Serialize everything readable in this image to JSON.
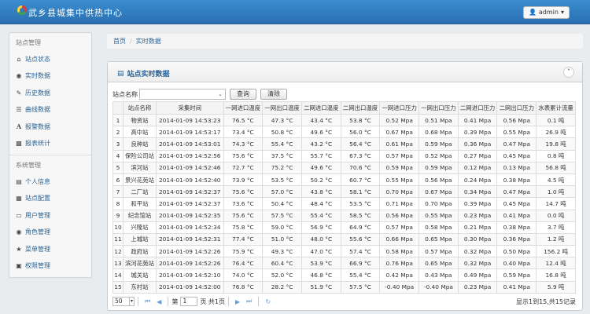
{
  "header": {
    "title": "武乡县城集中供热中心",
    "user_label": "admin",
    "user_icon": "user-icon"
  },
  "sidebar": {
    "section1": "站点管理",
    "items1": [
      {
        "label": "站点状态",
        "icon": "home-icon"
      },
      {
        "label": "实时数据",
        "icon": "eye-icon"
      },
      {
        "label": "历史数据",
        "icon": "edit-icon"
      },
      {
        "label": "曲线数据",
        "icon": "list-icon"
      },
      {
        "label": "报警数据",
        "icon": "font-icon"
      },
      {
        "label": "报表统计",
        "icon": "picture-icon"
      }
    ],
    "section2": "系统管理",
    "items2": [
      {
        "label": "个人信息",
        "icon": "list-alt-icon"
      },
      {
        "label": "站点配置",
        "icon": "grid-icon"
      },
      {
        "label": "用户管理",
        "icon": "folder-icon"
      },
      {
        "label": "角色管理",
        "icon": "globe-icon"
      },
      {
        "label": "菜单管理",
        "icon": "star-icon"
      },
      {
        "label": "权限管理",
        "icon": "lock-icon"
      }
    ]
  },
  "breadcrumb": {
    "home": "首页",
    "current": "实时数据"
  },
  "panel": {
    "title": "站点实时数据"
  },
  "filter": {
    "label": "站点名称",
    "select_value": "",
    "query": "查询",
    "clear": "清除"
  },
  "table": {
    "headers": [
      "",
      "站点名称",
      "采集时间",
      "一网进口温度",
      "一网出口温度",
      "二网进口温度",
      "二网出口温度",
      "一网进口压力",
      "一网出口压力",
      "二网进口压力",
      "二网出口压力",
      "水表累计流量"
    ],
    "rows": [
      [
        "1",
        "物资站",
        "2014-01-09 14:53:23",
        "76.5 °C",
        "47.3 °C",
        "43.4 °C",
        "53.8 °C",
        "0.52 Mpa",
        "0.51 Mpa",
        "0.41 Mpa",
        "0.56 Mpa",
        "0.1 吨"
      ],
      [
        "2",
        "高中站",
        "2014-01-09 14:53:17",
        "73.4 °C",
        "50.8 °C",
        "49.6 °C",
        "56.0 °C",
        "0.67 Mpa",
        "0.68 Mpa",
        "0.39 Mpa",
        "0.55 Mpa",
        "26.9 吨"
      ],
      [
        "3",
        "良种站",
        "2014-01-09 14:53:01",
        "74.3 °C",
        "55.4 °C",
        "43.2 °C",
        "56.4 °C",
        "0.61 Mpa",
        "0.59 Mpa",
        "0.36 Mpa",
        "0.47 Mpa",
        "19.8 吨"
      ],
      [
        "4",
        "保险公司站",
        "2014-01-09 14:52:56",
        "75.6 °C",
        "37.5 °C",
        "55.7 °C",
        "67.3 °C",
        "0.57 Mpa",
        "0.52 Mpa",
        "0.27 Mpa",
        "0.45 Mpa",
        "0.8 吨"
      ],
      [
        "5",
        "滨河站",
        "2014-01-09 14:52:46",
        "72.7 °C",
        "75.2 °C",
        "49.6 °C",
        "70.6 °C",
        "0.59 Mpa",
        "0.59 Mpa",
        "0.12 Mpa",
        "0.13 Mpa",
        "56.8 吨"
      ],
      [
        "6",
        "景兴花苑站",
        "2014-01-09 14:52:40",
        "73.9 °C",
        "53.5 °C",
        "50.2 °C",
        "60.7 °C",
        "0.55 Mpa",
        "0.56 Mpa",
        "0.24 Mpa",
        "0.38 Mpa",
        "4.5 吨"
      ],
      [
        "7",
        "二厂站",
        "2014-01-09 14:52:37",
        "75.6 °C",
        "57.0 °C",
        "43.8 °C",
        "58.1 °C",
        "0.70 Mpa",
        "0.67 Mpa",
        "0.34 Mpa",
        "0.47 Mpa",
        "1.0 吨"
      ],
      [
        "8",
        "和平站",
        "2014-01-09 14:52:37",
        "73.6 °C",
        "50.4 °C",
        "48.4 °C",
        "53.5 °C",
        "0.71 Mpa",
        "0.70 Mpa",
        "0.39 Mpa",
        "0.45 Mpa",
        "14.7 吨"
      ],
      [
        "9",
        "纪念馆站",
        "2014-01-09 14:52:35",
        "75.6 °C",
        "57.5 °C",
        "55.4 °C",
        "58.5 °C",
        "0.56 Mpa",
        "0.55 Mpa",
        "0.23 Mpa",
        "0.41 Mpa",
        "0.0 吨"
      ],
      [
        "10",
        "兴隆站",
        "2014-01-09 14:52:34",
        "75.8 °C",
        "59.0 °C",
        "56.9 °C",
        "64.9 °C",
        "0.57 Mpa",
        "0.58 Mpa",
        "0.21 Mpa",
        "0.38 Mpa",
        "3.7 吨"
      ],
      [
        "11",
        "上城站",
        "2014-01-09 14:52:31",
        "77.4 °C",
        "51.0 °C",
        "48.0 °C",
        "55.6 °C",
        "0.66 Mpa",
        "0.65 Mpa",
        "0.30 Mpa",
        "0.36 Mpa",
        "1.2 吨"
      ],
      [
        "12",
        "政府站",
        "2014-01-09 14:52:26",
        "75.9 °C",
        "49.3 °C",
        "47.0 °C",
        "57.4 °C",
        "0.58 Mpa",
        "0.57 Mpa",
        "0.32 Mpa",
        "0.50 Mpa",
        "156.2 吨"
      ],
      [
        "13",
        "滨河花苑站",
        "2014-01-09 14:52:26",
        "76.4 °C",
        "60.4 °C",
        "53.9 °C",
        "66.9 °C",
        "0.76 Mpa",
        "0.65 Mpa",
        "0.32 Mpa",
        "0.40 Mpa",
        "12.4 吨"
      ],
      [
        "14",
        "城关站",
        "2014-01-09 14:52:10",
        "74.0 °C",
        "52.0 °C",
        "46.8 °C",
        "55.4 °C",
        "0.42 Mpa",
        "0.43 Mpa",
        "0.49 Mpa",
        "0.59 Mpa",
        "16.8 吨"
      ],
      [
        "15",
        "东村站",
        "2014-01-09 14:52:00",
        "76.8 °C",
        "28.2 °C",
        "51.9 °C",
        "57.5 °C",
        "-0.40 Mpa",
        "-0.40 Mpa",
        "0.23 Mpa",
        "0.41 Mpa",
        "5.9 吨"
      ]
    ]
  },
  "pager": {
    "page_size": "50",
    "page_prefix": "第",
    "page_value": "1",
    "page_suffix": "页 共1页",
    "info": "显示1到15,共15记录"
  }
}
